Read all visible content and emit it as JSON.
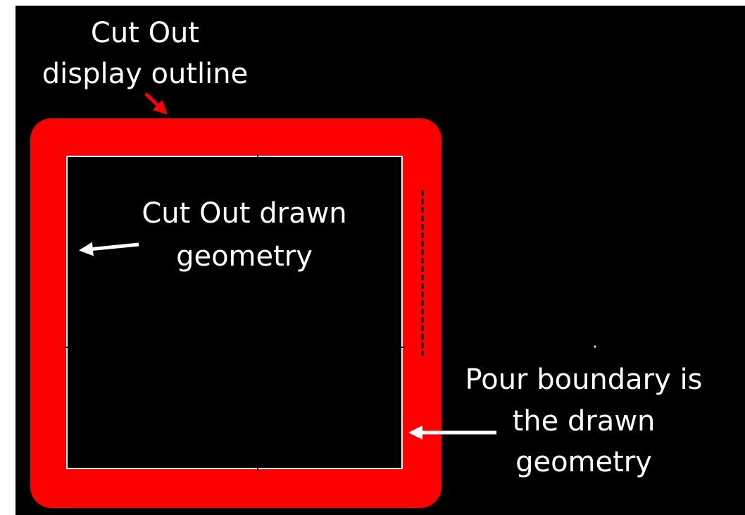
{
  "annotations": {
    "display_outline_line1": "Cut Out",
    "display_outline_line2": "display outline",
    "drawn_geometry_line1": "Cut Out drawn",
    "drawn_geometry_line2": "geometry",
    "pour_boundary_line1": "Pour boundary is",
    "pour_boundary_line2": "the drawn",
    "pour_boundary_line3": "geometry"
  },
  "colors": {
    "background": "#000000",
    "outline": "#ff0000",
    "geometry": "#ffffff",
    "arrow_display": "#ff0000",
    "arrow_geometry": "#ffffff"
  }
}
